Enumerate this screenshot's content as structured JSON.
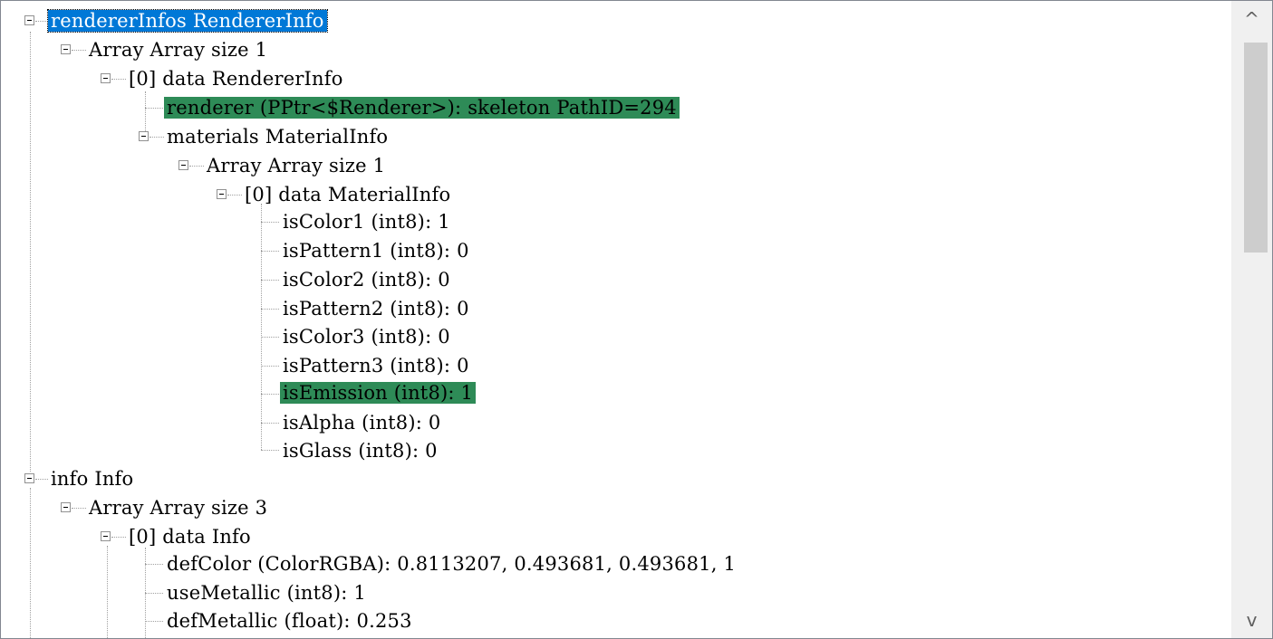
{
  "tree": {
    "nodes": [
      {
        "label": "rendererInfos RendererInfo",
        "expandable": true,
        "state": "selected"
      },
      {
        "label": "Array Array size 1",
        "expandable": true
      },
      {
        "label": "[0] data RendererInfo",
        "expandable": true
      },
      {
        "label": "renderer (PPtr<$Renderer>): skeleton PathID=294",
        "expandable": false,
        "state": "highlighted"
      },
      {
        "label": "materials MaterialInfo",
        "expandable": true
      },
      {
        "label": "Array Array size 1",
        "expandable": true
      },
      {
        "label": "[0] data MaterialInfo",
        "expandable": true
      },
      {
        "label": "isColor1 (int8): 1",
        "expandable": false
      },
      {
        "label": "isPattern1 (int8): 0",
        "expandable": false
      },
      {
        "label": "isColor2 (int8): 0",
        "expandable": false
      },
      {
        "label": "isPattern2 (int8): 0",
        "expandable": false
      },
      {
        "label": "isColor3 (int8): 0",
        "expandable": false
      },
      {
        "label": "isPattern3 (int8): 0",
        "expandable": false
      },
      {
        "label": "isEmission (int8): 1",
        "expandable": false,
        "state": "highlighted"
      },
      {
        "label": "isAlpha (int8): 0",
        "expandable": false
      },
      {
        "label": "isGlass (int8): 0",
        "expandable": false
      },
      {
        "label": "info Info",
        "expandable": true
      },
      {
        "label": "Array Array size 3",
        "expandable": true
      },
      {
        "label": "[0] data Info",
        "expandable": true
      },
      {
        "label": "defColor (ColorRGBA): 0.8113207, 0.493681, 0.493681, 1",
        "expandable": false
      },
      {
        "label": "useMetallic (int8): 1",
        "expandable": false
      },
      {
        "label": "defMetallic (float): 0.253",
        "expandable": false
      }
    ]
  },
  "scrollbar": {
    "up_icon": "chevron-up-icon",
    "down_icon": "chevron-down-icon",
    "up_glyph": "^",
    "down_glyph": "v"
  },
  "colors": {
    "selected": "#0078d7",
    "highlighted": "#2e8b57"
  }
}
